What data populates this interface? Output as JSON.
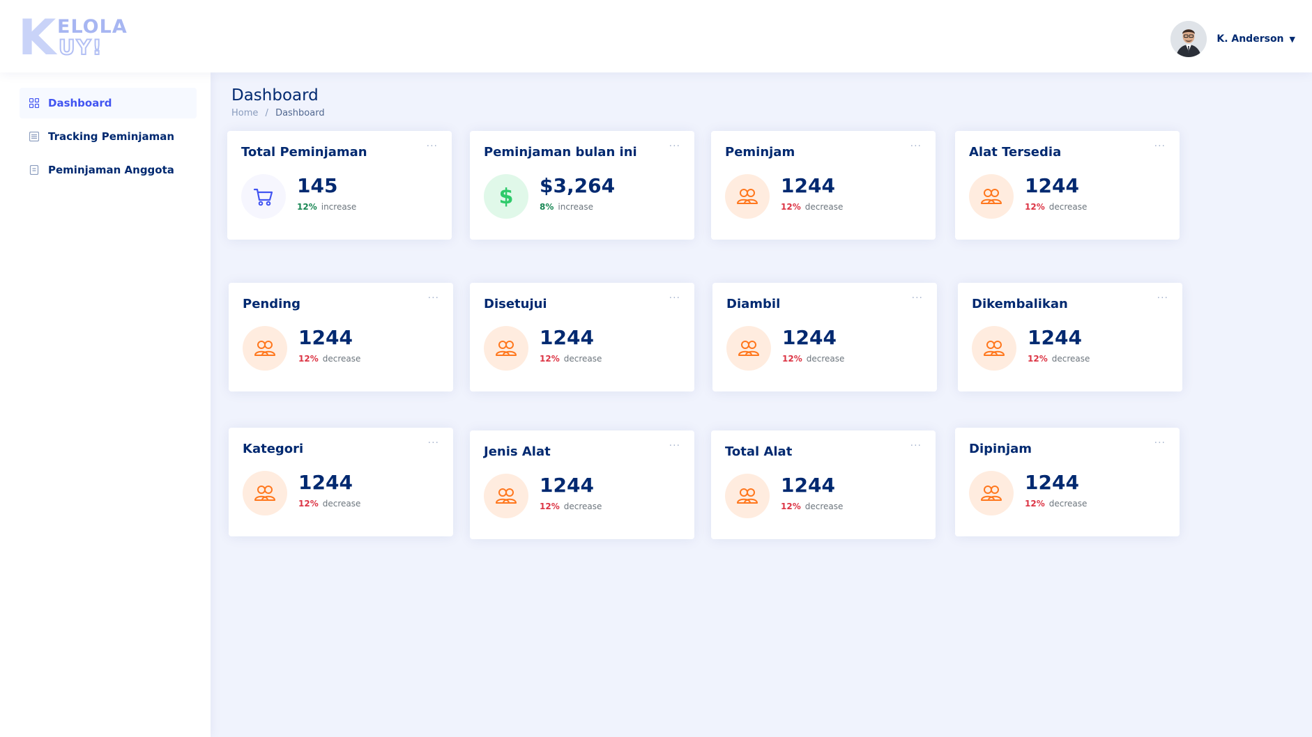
{
  "header": {
    "logo": {
      "line1": "ELOLA",
      "line2": "UY!",
      "big_letter": "K"
    },
    "user_name": "K. Anderson",
    "caret": "▼"
  },
  "sidebar": {
    "items": [
      {
        "label": "Dashboard",
        "icon": "grid-icon",
        "active": true
      },
      {
        "label": "Tracking Peminjaman",
        "icon": "list-icon",
        "active": false
      },
      {
        "label": "Peminjaman Anggota",
        "icon": "document-icon",
        "active": false
      }
    ]
  },
  "main": {
    "title": "Dashboard",
    "breadcrumb": {
      "home": "Home",
      "separator": "/",
      "current": "Dashboard"
    }
  },
  "cards": [
    {
      "title": "Total Peminjaman",
      "value": "145",
      "pct": "12%",
      "trend": "increase",
      "direction": "up",
      "icon": "cart-icon",
      "tone": "blue"
    },
    {
      "title": "Peminjaman bulan ini",
      "value": "$3,264",
      "pct": "8%",
      "trend": "increase",
      "direction": "up",
      "icon": "dollar-icon",
      "tone": "green"
    },
    {
      "title": "Peminjam",
      "value": "1244",
      "pct": "12%",
      "trend": "decrease",
      "direction": "down",
      "icon": "people-icon",
      "tone": "orange"
    },
    {
      "title": "Alat Tersedia",
      "value": "1244",
      "pct": "12%",
      "trend": "decrease",
      "direction": "down",
      "icon": "people-icon",
      "tone": "orange"
    },
    {
      "title": "Pending",
      "value": "1244",
      "pct": "12%",
      "trend": "decrease",
      "direction": "down",
      "icon": "people-icon",
      "tone": "orange"
    },
    {
      "title": "Disetujui",
      "value": "1244",
      "pct": "12%",
      "trend": "decrease",
      "direction": "down",
      "icon": "people-icon",
      "tone": "orange"
    },
    {
      "title": "Diambil",
      "value": "1244",
      "pct": "12%",
      "trend": "decrease",
      "direction": "down",
      "icon": "people-icon",
      "tone": "orange"
    },
    {
      "title": "Dikembalikan",
      "value": "1244",
      "pct": "12%",
      "trend": "decrease",
      "direction": "down",
      "icon": "people-icon",
      "tone": "orange"
    },
    {
      "title": "Kategori",
      "value": "1244",
      "pct": "12%",
      "trend": "decrease",
      "direction": "down",
      "icon": "people-icon",
      "tone": "orange"
    },
    {
      "title": "Jenis Alat",
      "value": "1244",
      "pct": "12%",
      "trend": "decrease",
      "direction": "down",
      "icon": "people-icon",
      "tone": "orange"
    },
    {
      "title": "Total Alat",
      "value": "1244",
      "pct": "12%",
      "trend": "decrease",
      "direction": "down",
      "icon": "people-icon",
      "tone": "orange"
    },
    {
      "title": "Dipinjam",
      "value": "1244",
      "pct": "12%",
      "trend": "decrease",
      "direction": "down",
      "icon": "people-icon",
      "tone": "orange"
    }
  ],
  "card_menu": "···",
  "colors": {
    "accent": "#4154f1",
    "navy": "#012970",
    "increase": "#198754",
    "decrease": "#dc3545",
    "orange_icon": "#ff771d",
    "green_icon": "#2eca6a",
    "main_bg": "#f0f3fd"
  }
}
